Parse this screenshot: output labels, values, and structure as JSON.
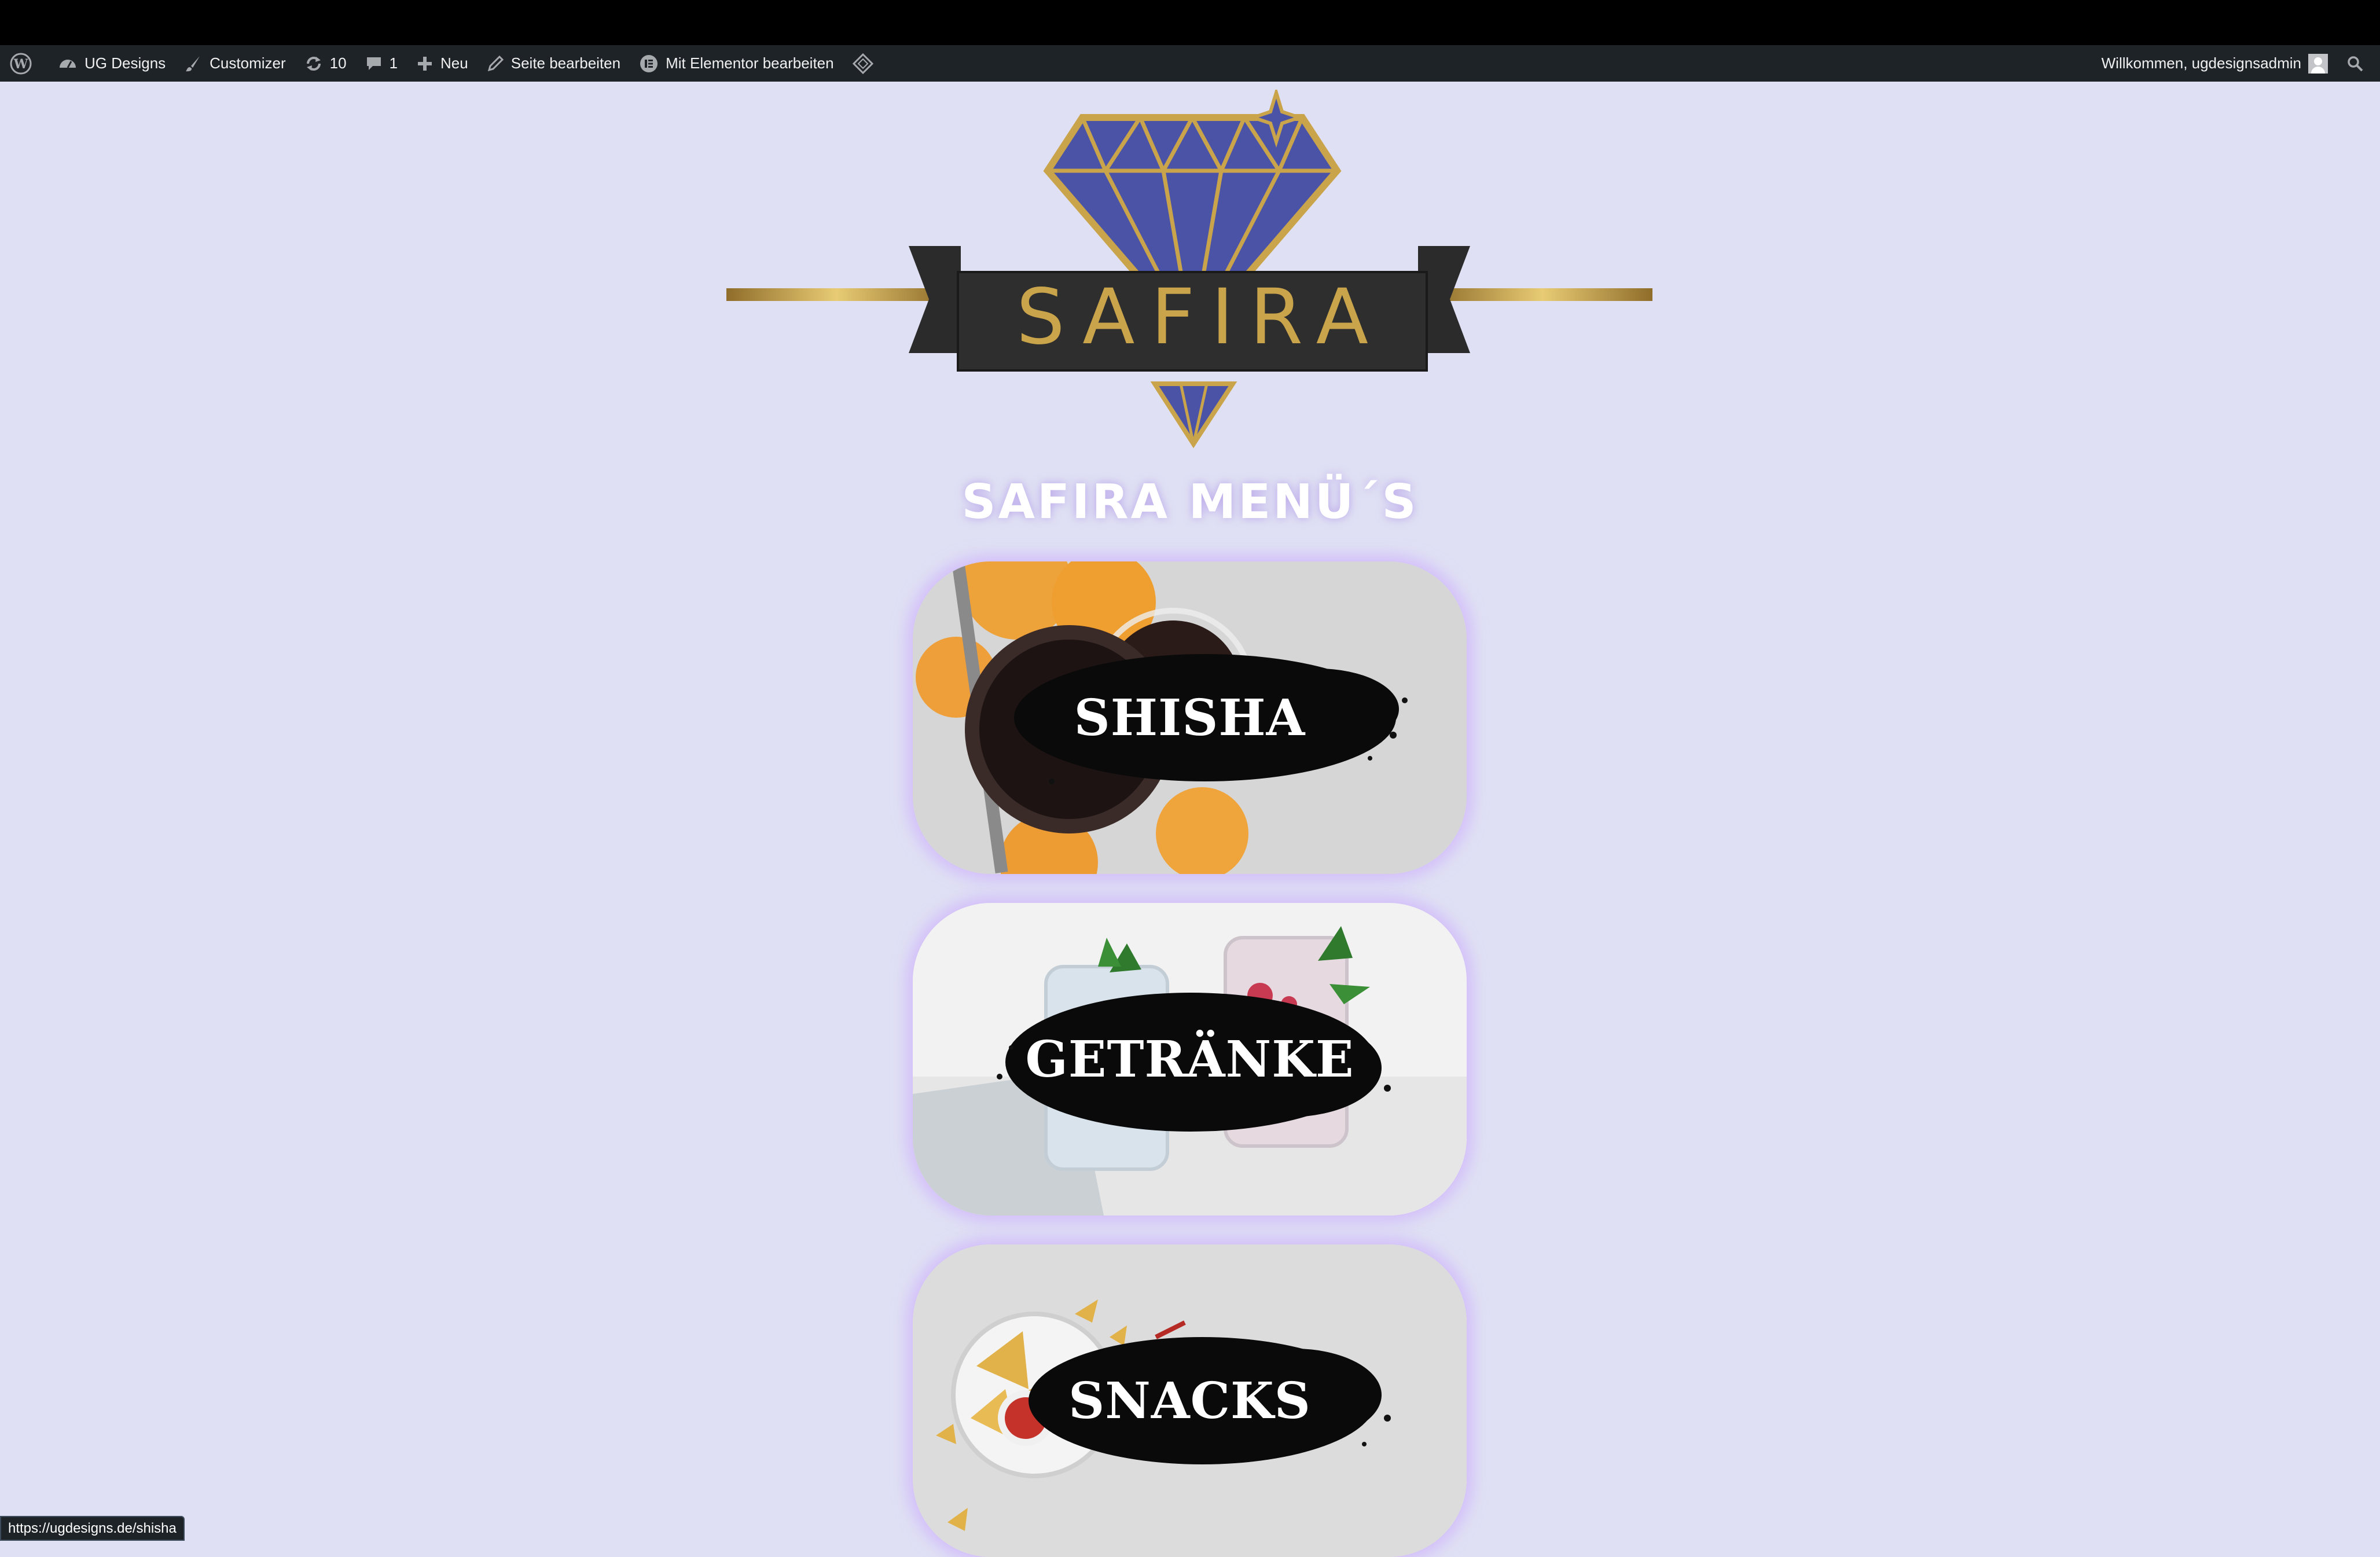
{
  "adminbar": {
    "site_name": "UG Designs",
    "customizer": "Customizer",
    "updates_count": "10",
    "comments_count": "1",
    "new": "Neu",
    "edit_page": "Seite bearbeiten",
    "edit_elementor": "Mit Elementor bearbeiten",
    "welcome": "Willkommen, ugdesignsadmin"
  },
  "logo": {
    "text": "SAFIRA"
  },
  "heading": "SAFIRA MENÜ´S",
  "menu": [
    {
      "label": "SHISHA"
    },
    {
      "label": "GETRÄNKE"
    },
    {
      "label": "SNACKS"
    }
  ],
  "status_url": "https://ugdesigns.de/shisha",
  "colors": {
    "background": "#dfe0f4",
    "gold": "#c9a44a",
    "sapphire": "#4b53a6",
    "adminbar": "#1d2327"
  }
}
